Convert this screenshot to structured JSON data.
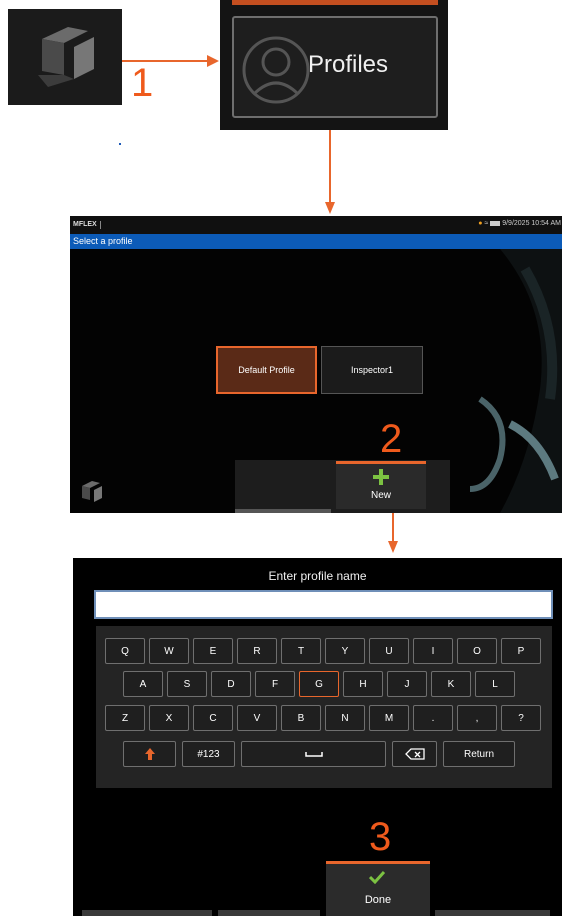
{
  "step_labels": [
    "1",
    "2",
    "3"
  ],
  "icons": {
    "app_logo": "app-logo-icon",
    "profile_avatar": "user-circle-icon",
    "new": "plus-icon",
    "done": "checkmark-icon",
    "shift": "shift-up-arrow-icon",
    "space": "space-bar-icon",
    "backspace": "backspace-icon"
  },
  "colors": {
    "accent": "#E8662C",
    "title_bar": "#0C5BB8",
    "new_plus": "#7CC242",
    "done_check": "#7CC242"
  },
  "profiles_tile": {
    "label": "Profiles"
  },
  "profile_screen": {
    "status_bar": {
      "app_name": "MFLEX",
      "datetime": "9/9/2025 10:54 AM"
    },
    "title": "Select a profile",
    "profiles": [
      {
        "label": "Default Profile",
        "selected": true
      },
      {
        "label": "Inspector1",
        "selected": false
      }
    ],
    "new_button": {
      "label": "New"
    }
  },
  "keyboard_screen": {
    "title": "Enter profile name",
    "input_value": "",
    "rows": [
      [
        "Q",
        "W",
        "E",
        "R",
        "T",
        "Y",
        "U",
        "I",
        "O",
        "P"
      ],
      [
        "A",
        "S",
        "D",
        "F",
        "G",
        "H",
        "J",
        "K",
        "L"
      ],
      [
        "Z",
        "X",
        "C",
        "V",
        "B",
        "N",
        "M",
        ".",
        ",",
        "?"
      ]
    ],
    "highlighted_key": "G",
    "bottom_row": {
      "symbols_label": "#123",
      "return_label": "Return"
    },
    "done_button": {
      "label": "Done"
    }
  }
}
